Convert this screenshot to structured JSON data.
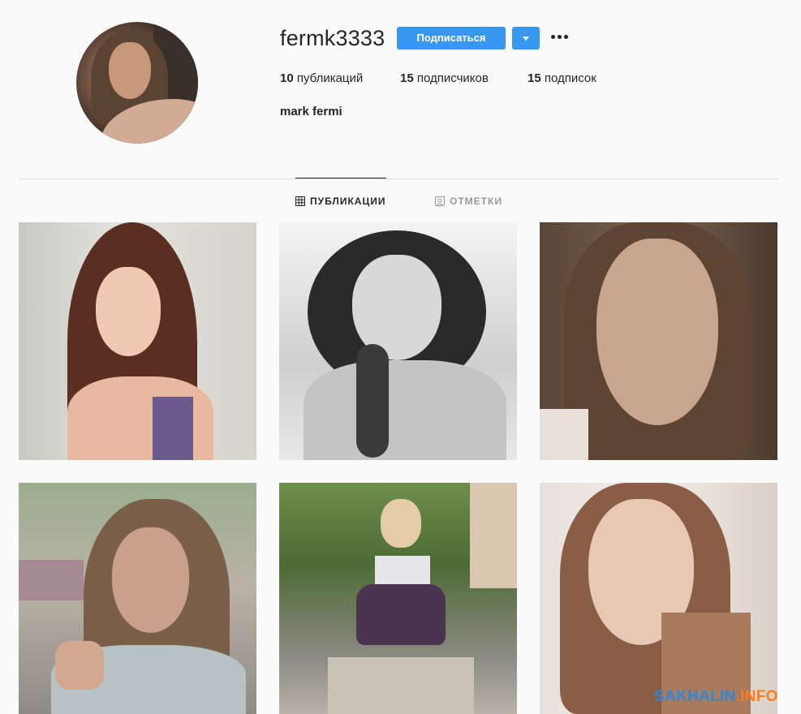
{
  "profile": {
    "username": "fermk3333",
    "full_name": "mark fermi",
    "follow_label": "Подписаться",
    "stats": [
      {
        "count": "10",
        "label": "публикаций"
      },
      {
        "count": "15",
        "label": "подписчиков"
      },
      {
        "count": "15",
        "label": "подписок"
      }
    ]
  },
  "tabs": [
    {
      "label": "ПУБЛИКАЦИИ",
      "active": true,
      "icon": "grid-icon"
    },
    {
      "label": "ОТМЕТКИ",
      "active": false,
      "icon": "tagged-icon"
    }
  ],
  "posts": [
    {
      "index": 1
    },
    {
      "index": 2
    },
    {
      "index": 3
    },
    {
      "index": 4
    },
    {
      "index": 5
    },
    {
      "index": 6
    }
  ],
  "watermark": {
    "part1": "SAKHALIN",
    "part2": ".INFO"
  },
  "colors": {
    "accent": "#3897f0",
    "text": "#262626",
    "muted": "#999999",
    "background": "#fafafa"
  }
}
